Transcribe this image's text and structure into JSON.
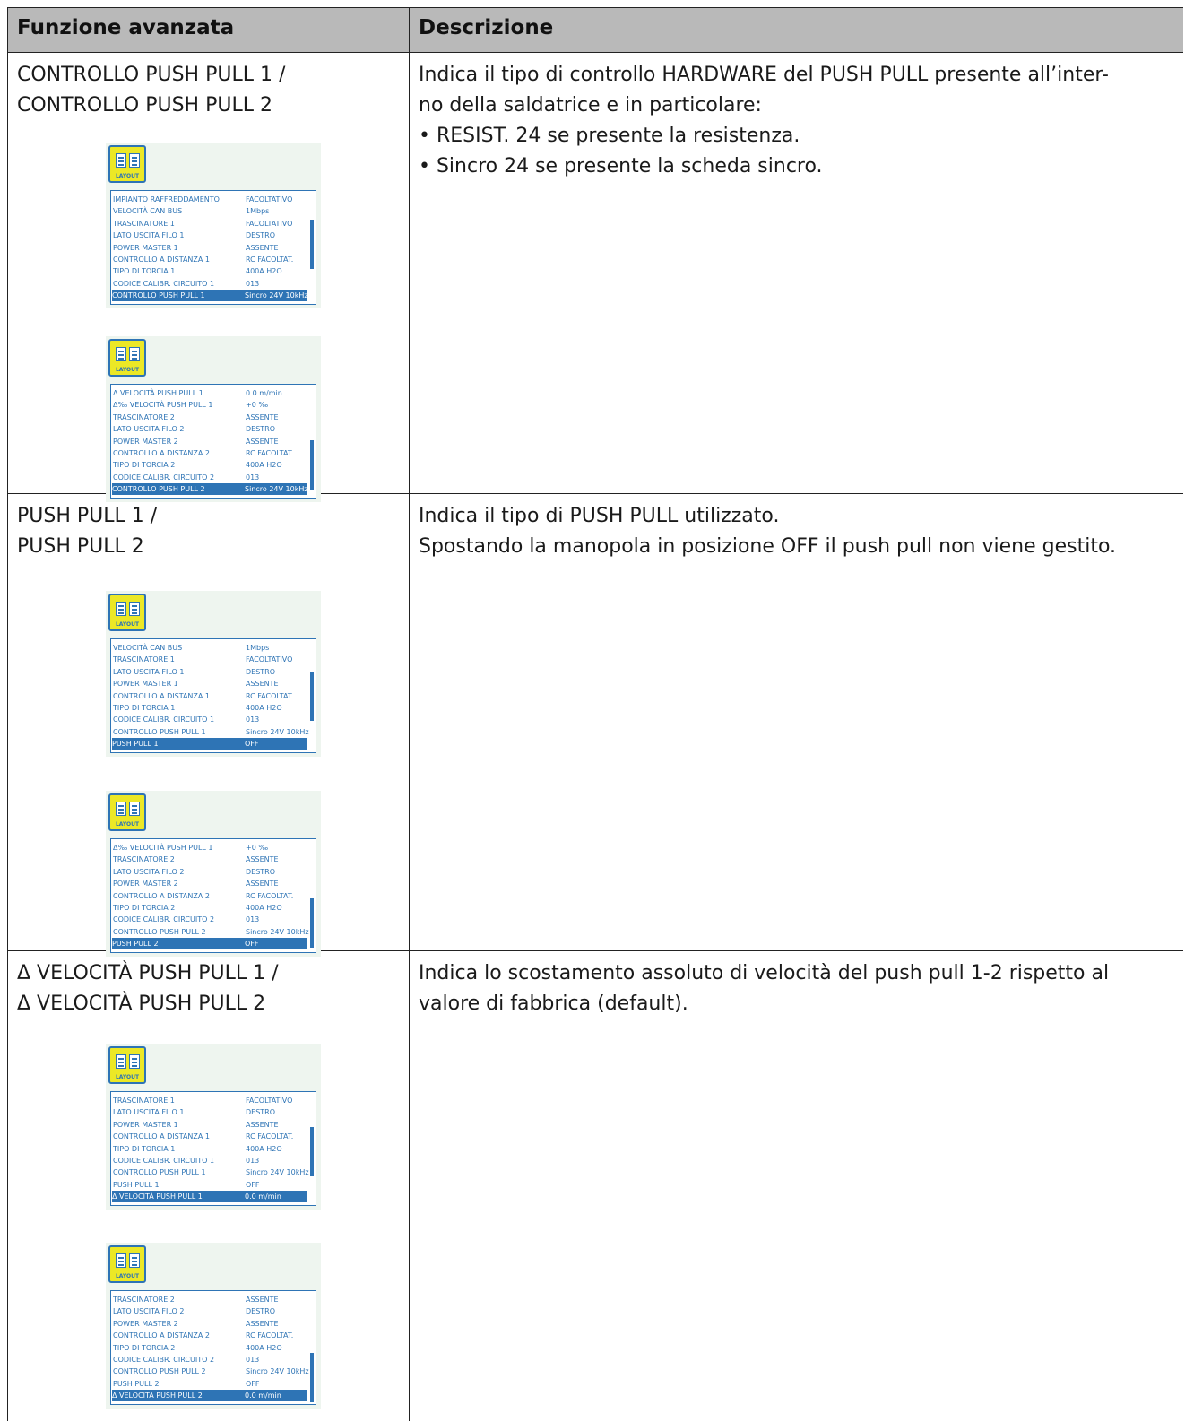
{
  "header": {
    "col1": "Funzione avanzata",
    "col2": "Descrizione"
  },
  "rows": [
    {
      "func_lines": [
        "CONTROLLO PUSH PULL 1 /",
        "CONTROLLO PUSH PULL 2"
      ],
      "desc_lines": [
        "Indica il tipo di controllo HARDWARE del PUSH PULL presente all’inter-",
        "no della saldatrice e in particolare:",
        "• RESIST. 24 se presente la resistenza.",
        "• Sincro 24 se presente la scheda sincro."
      ],
      "screens": [
        {
          "icon_label": "LAYOUT",
          "scroll_pos": 0.45,
          "items": [
            {
              "key": "IMPIANTO RAFFREDDAMENTO",
              "value": "FACOLTATIVO"
            },
            {
              "key": "VELOCITÀ CAN BUS",
              "value": "1Mbps"
            },
            {
              "key": "TRASCINATORE 1",
              "value": "FACOLTATIVO"
            },
            {
              "key": "LATO USCITA FILO 1",
              "value": "DESTRO"
            },
            {
              "key": "POWER MASTER 1",
              "value": "ASSENTE"
            },
            {
              "key": "CONTROLLO A DISTANZA 1",
              "value": "RC FACOLTAT."
            },
            {
              "key": "TIPO DI TORCIA 1",
              "value": "400A H2O"
            },
            {
              "key": "CODICE CALIBR. CIRCUITO 1",
              "value": "013"
            },
            {
              "key": "CONTROLLO PUSH PULL 1",
              "value": "Sincro 24V 10kHz",
              "selected": true
            }
          ]
        },
        {
          "icon_label": "LAYOUT",
          "scroll_pos": 0.9,
          "items": [
            {
              "key": "Δ VELOCITÀ PUSH PULL 1",
              "value": "0.0 m/min"
            },
            {
              "key": "Δ‰ VELOCITÀ PUSH PULL 1",
              "value": "+0 ‰"
            },
            {
              "key": "TRASCINATORE 2",
              "value": "ASSENTE"
            },
            {
              "key": "LATO USCITA FILO 2",
              "value": "DESTRO"
            },
            {
              "key": "POWER MASTER 2",
              "value": "ASSENTE"
            },
            {
              "key": "CONTROLLO A DISTANZA 2",
              "value": "RC FACOLTAT."
            },
            {
              "key": "TIPO DI TORCIA 2",
              "value": "400A H2O"
            },
            {
              "key": "CODICE CALIBR. CIRCUITO 2",
              "value": "013"
            },
            {
              "key": "CONTROLLO PUSH PULL 2",
              "value": "Sincro 24V 10kHz",
              "selected": true
            }
          ]
        }
      ]
    },
    {
      "func_lines": [
        "PUSH PULL 1 /",
        "PUSH PULL 2"
      ],
      "desc_lines": [
        "Indica il tipo di PUSH PULL utilizzato.",
        "Spostando la manopola in posizione OFF il push pull non viene gestito."
      ],
      "screens": [
        {
          "icon_label": "LAYOUT",
          "scroll_pos": 0.5,
          "items": [
            {
              "key": "VELOCITÀ CAN BUS",
              "value": "1Mbps"
            },
            {
              "key": "TRASCINATORE 1",
              "value": "FACOLTATIVO"
            },
            {
              "key": "LATO USCITA FILO 1",
              "value": "DESTRO"
            },
            {
              "key": "POWER MASTER 1",
              "value": "ASSENTE"
            },
            {
              "key": "CONTROLLO A DISTANZA 1",
              "value": "RC FACOLTAT."
            },
            {
              "key": "TIPO DI TORCIA 1",
              "value": "400A H2O"
            },
            {
              "key": "CODICE CALIBR. CIRCUITO 1",
              "value": "013"
            },
            {
              "key": "CONTROLLO PUSH PULL 1",
              "value": "Sincro 24V 10kHz"
            },
            {
              "key": "PUSH PULL 1",
              "value": "OFF",
              "selected": true
            }
          ]
        },
        {
          "icon_label": "LAYOUT",
          "scroll_pos": 0.95,
          "items": [
            {
              "key": "Δ‰ VELOCITÀ PUSH PULL 1",
              "value": "+0 ‰"
            },
            {
              "key": "TRASCINATORE 2",
              "value": "ASSENTE"
            },
            {
              "key": "LATO USCITA FILO 2",
              "value": "DESTRO"
            },
            {
              "key": "POWER MASTER 2",
              "value": "ASSENTE"
            },
            {
              "key": "CONTROLLO A DISTANZA 2",
              "value": "RC FACOLTAT."
            },
            {
              "key": "TIPO DI TORCIA 2",
              "value": "400A H2O"
            },
            {
              "key": "CODICE CALIBR. CIRCUITO 2",
              "value": "013"
            },
            {
              "key": "CONTROLLO PUSH PULL 2",
              "value": "Sincro 24V 10kHz"
            },
            {
              "key": "PUSH PULL 2",
              "value": "OFF",
              "selected": true
            }
          ]
        }
      ]
    },
    {
      "func_lines": [
        "Δ VELOCITÀ PUSH PULL 1 /",
        "Δ VELOCITÀ PUSH PULL 2"
      ],
      "desc_lines": [
        "Indica lo scostamento assoluto di velocità del push pull 1-2 rispetto al",
        "valore di fabbrica (default)."
      ],
      "screens": [
        {
          "icon_label": "LAYOUT",
          "scroll_pos": 0.55,
          "items": [
            {
              "key": "TRASCINATORE 1",
              "value": "FACOLTATIVO"
            },
            {
              "key": "LATO USCITA FILO 1",
              "value": "DESTRO"
            },
            {
              "key": "POWER MASTER 1",
              "value": "ASSENTE"
            },
            {
              "key": "CONTROLLO A DISTANZA 1",
              "value": "RC FACOLTAT."
            },
            {
              "key": "TIPO DI TORCIA 1",
              "value": "400A H2O"
            },
            {
              "key": "CODICE CALIBR. CIRCUITO 1",
              "value": "013"
            },
            {
              "key": "CONTROLLO PUSH PULL 1",
              "value": "Sincro 24V 10kHz"
            },
            {
              "key": "PUSH PULL 1",
              "value": "OFF"
            },
            {
              "key": "Δ VELOCITÀ PUSH PULL 1",
              "value": "0.0 m/min",
              "selected": true
            }
          ]
        },
        {
          "icon_label": "LAYOUT",
          "scroll_pos": 1.0,
          "items": [
            {
              "key": "TRASCINATORE 2",
              "value": "ASSENTE"
            },
            {
              "key": "LATO USCITA FILO 2",
              "value": "DESTRO"
            },
            {
              "key": "POWER MASTER 2",
              "value": "ASSENTE"
            },
            {
              "key": "CONTROLLO A DISTANZA 2",
              "value": "RC FACOLTAT."
            },
            {
              "key": "TIPO DI TORCIA 2",
              "value": "400A H2O"
            },
            {
              "key": "CODICE CALIBR. CIRCUITO 2",
              "value": "013"
            },
            {
              "key": "CONTROLLO PUSH PULL 2",
              "value": "Sincro 24V 10kHz"
            },
            {
              "key": "PUSH PULL 2",
              "value": "OFF"
            },
            {
              "key": "Δ VELOCITÀ PUSH PULL 2",
              "value": "0.0 m/min",
              "selected": true
            }
          ]
        }
      ]
    }
  ]
}
